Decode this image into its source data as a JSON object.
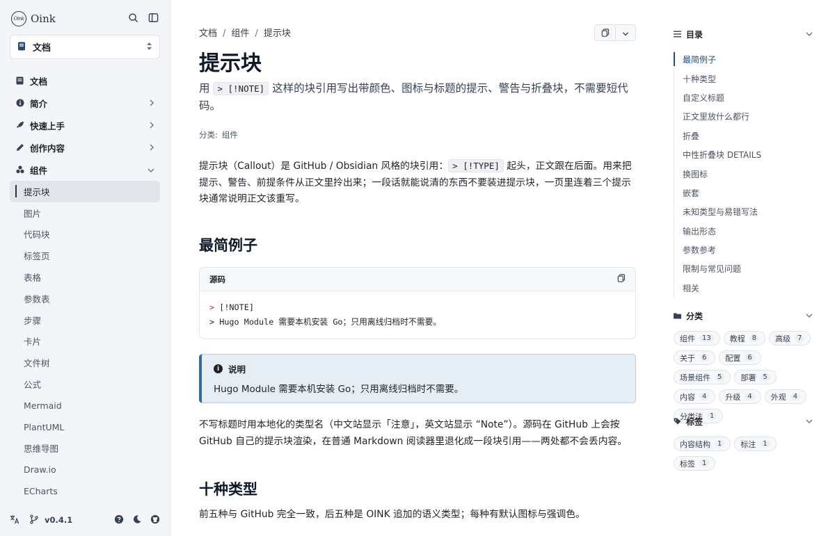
{
  "app": {
    "logo_text": "Oink",
    "logo_mark": "Oink"
  },
  "sidebar": {
    "doc_selector": "文档",
    "nav": [
      {
        "label": "文档",
        "icon": "book-icon",
        "chevron": false
      },
      {
        "label": "简介",
        "icon": "info-icon",
        "chevron": true
      },
      {
        "label": "快速上手",
        "icon": "rocket-icon",
        "chevron": true
      },
      {
        "label": "创作内容",
        "icon": "pen-icon",
        "chevron": true
      },
      {
        "label": "组件",
        "icon": "components-icon",
        "chevron": true,
        "expanded": true
      }
    ],
    "sub_items": [
      "提示块",
      "图片",
      "代码块",
      "标签页",
      "表格",
      "参数表",
      "步骤",
      "卡片",
      "文件树",
      "公式",
      "Mermaid",
      "PlantUML",
      "思维导图",
      "Draw.io",
      "ECharts"
    ],
    "active_sub": "提示块",
    "version": "v0.4.1"
  },
  "main": {
    "breadcrumb": [
      "文档",
      "组件",
      "提示块"
    ],
    "title": "提示块",
    "lead_before": "用 ",
    "lead_code": "> [!NOTE]",
    "lead_after": " 这样的块引用写出带颜色、图标与标题的提示、警告与折叠块，不需要短代码。",
    "category_label": "分类:",
    "category_value": "组件",
    "intro_before": "提示块（Callout）是 GitHub / Obsidian 风格的块引用：",
    "intro_code": "> [!TYPE]",
    "intro_after": " 起头，正文跟在后面。用来把提示、警告、前提条件从正文里拎出来；一段话就能说清的东西不要装进提示块，一页里连着三个提示块通常说明正文该重写。",
    "h2_simplest": "最简例子",
    "code_block": {
      "title": "源码",
      "line1_marker": ">",
      "line1_text": " [!NOTE]",
      "line2": "> Hugo Module 需要本机安装 Go；只用离线归档时不需要。"
    },
    "callout": {
      "title": "说明",
      "body": "Hugo Module 需要本机安装 Go；只用离线归档时不需要。"
    },
    "para_after_callout": "不写标题时用本地化的类型名（中文站显示「注意」，英文站显示 “Note”）。源码在 GitHub 上会按 GitHub 自己的提示块渲染，在普通 Markdown 阅读器里退化成一段块引用——两处都不会丢内容。",
    "h2_types": "十种类型",
    "para_types": "前五种与 GitHub 完全一致，后五种是 OINK 追加的语义类型；每种有默认图标与强调色。"
  },
  "toc": {
    "title": "目录",
    "items": [
      "最简例子",
      "十种类型",
      "自定义标题",
      "正文里放什么都行",
      "折叠",
      "中性折叠块 DETAILS",
      "换图标",
      "嵌套",
      "未知类型与易错写法",
      "输出形态",
      "参数参考",
      "限制与常见问题",
      "相关"
    ],
    "active": "最简例子"
  },
  "categories": {
    "title": "分类",
    "items": [
      {
        "label": "组件",
        "count": "13"
      },
      {
        "label": "教程",
        "count": "8"
      },
      {
        "label": "高级",
        "count": "7"
      },
      {
        "label": "关于",
        "count": "6"
      },
      {
        "label": "配置",
        "count": "6"
      },
      {
        "label": "场景组件",
        "count": "5"
      },
      {
        "label": "部署",
        "count": "5"
      },
      {
        "label": "内容",
        "count": "4"
      },
      {
        "label": "升级",
        "count": "4"
      },
      {
        "label": "外观",
        "count": "4"
      },
      {
        "label": "分类法",
        "count": "1"
      }
    ]
  },
  "tags": {
    "title": "标签",
    "items": [
      {
        "label": "内容结构",
        "count": "1"
      },
      {
        "label": "标注",
        "count": "1"
      },
      {
        "label": "标签",
        "count": "1"
      }
    ]
  },
  "colors": {
    "accent": "#1f4f7a",
    "callout_border": "#2e6e99",
    "callout_bg": "#e6eef5",
    "sidebar_bg": "#f3f5f8"
  }
}
